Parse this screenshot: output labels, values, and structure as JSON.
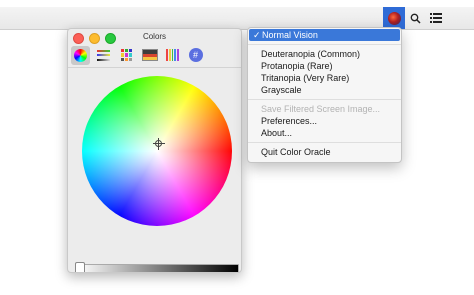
{
  "colors": {
    "accent": "#3a78d9",
    "menubar_icon_bg": "#2f6bd6",
    "close": "#fc5f57",
    "minimize": "#fdbc2e",
    "zoom": "#28c840"
  },
  "menubar": {
    "icons": [
      "color-oracle-icon",
      "search-icon",
      "list-icon"
    ]
  },
  "colors_panel": {
    "title": "Colors",
    "toolbar": [
      "color-wheel-icon",
      "sliders-icon",
      "palettes-icon",
      "image-palette-icon",
      "pencils-icon",
      "globe-icon"
    ]
  },
  "menu": {
    "check": "✓",
    "normal_vision": "Normal Vision",
    "deuteranopia": "Deuteranopia (Common)",
    "protanopia": "Protanopia (Rare)",
    "tritanopia": "Tritanopia (Very Rare)",
    "grayscale": "Grayscale",
    "save_filtered": "Save Filtered Screen Image...",
    "preferences": "Preferences...",
    "about": "About...",
    "quit": "Quit Color Oracle"
  }
}
